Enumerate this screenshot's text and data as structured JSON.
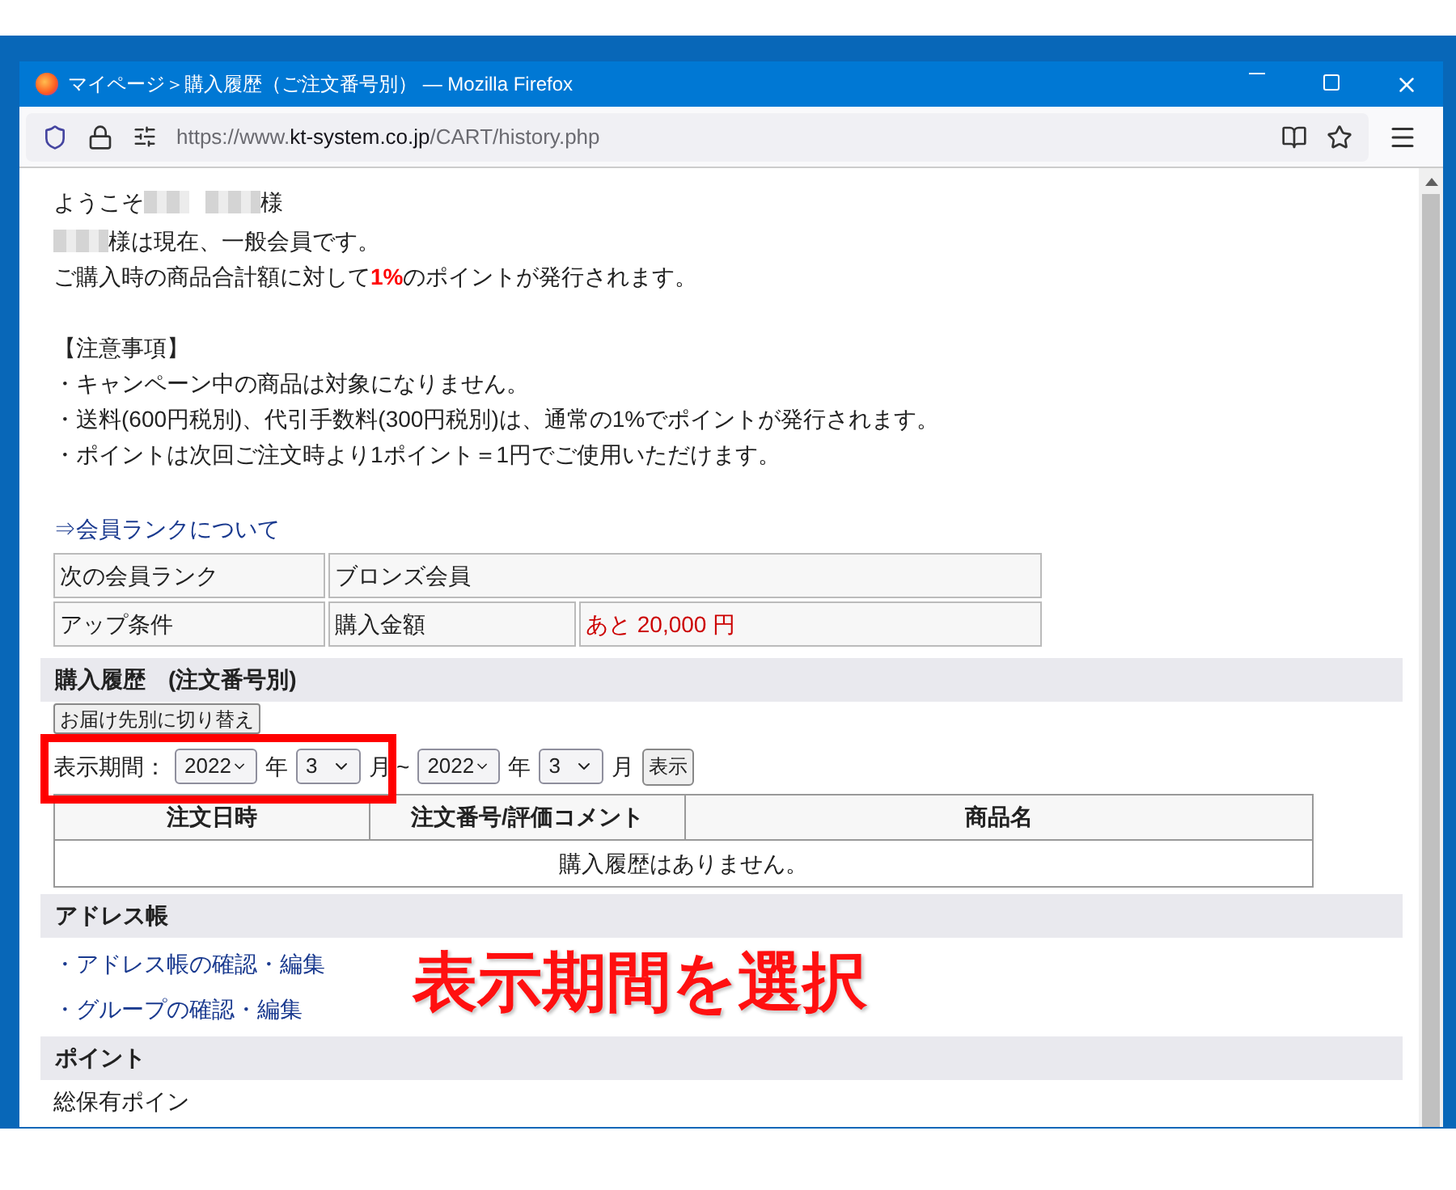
{
  "window": {
    "title": "マイページ＞購入履歴（ご注文番号別） — Mozilla Firefox"
  },
  "address_bar": {
    "url_prefix": "https://www.",
    "url_domain": "kt-system.co.jp",
    "url_path": "/CART/history.php"
  },
  "greeting": {
    "before": "ようこそ",
    "after": "様"
  },
  "member_status": "様は現在、一般会員です。",
  "points_note": "ご購入時の商品合計額に対して**1%**のポイントが発行されます。",
  "notice": {
    "heading": "【注意事項】",
    "items": [
      "・キャンペーン中の商品は対象になりません。",
      "・送料(600円税別)、代引手数料(300円税別)は、通常の1%でポイントが発行されます。",
      "・ポイントは次回ご注文時より1ポイント＝1円でご使用いただけます。"
    ]
  },
  "rank_link": "⇒会員ランクについて",
  "rank_table": [
    {
      "label": "次の会員ランク",
      "value": "ブロンズ会員"
    },
    {
      "label": "アップ条件",
      "value": "購入金額",
      "extra": "あと 20,000 円"
    }
  ],
  "history": {
    "title": "購入履歴　(注文番号別)",
    "switch_button": "お届け先別に切り替え",
    "period_label": "表示期間：",
    "from_year": "2022",
    "year_unit": "年",
    "from_month": "3",
    "month_unit": "月",
    "tilde": "~",
    "to_year": "2022",
    "to_year_unit": "年",
    "to_month": "3",
    "to_month_unit": "月",
    "show_button": "表示",
    "columns": [
      "注文日時",
      "注文番号/評価コメント",
      "商品名"
    ],
    "empty_message": "購入履歴はありません。"
  },
  "address_book": {
    "title": "アドレス帳",
    "links": [
      "・アドレス帳の確認・編集",
      "・グループの確認・編集"
    ]
  },
  "points": {
    "title": "ポイント",
    "label": "総保有ポイン"
  },
  "annotation": {
    "text": "表示期間を選択"
  }
}
